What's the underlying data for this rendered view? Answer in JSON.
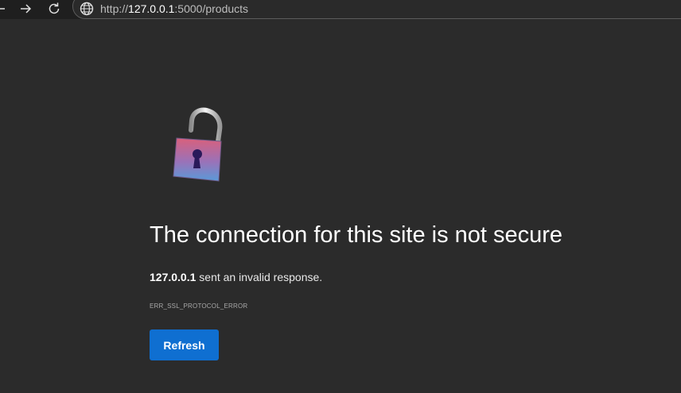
{
  "browser": {
    "url_scheme": "http://",
    "url_host": "127.0.0.1",
    "url_rest": ":5000/products",
    "icons": [
      "back-arrow-icon",
      "forward-arrow-icon",
      "reload-icon",
      "globe-icon"
    ]
  },
  "error_page": {
    "title": "The connection for this site is not secure",
    "host": "127.0.0.1",
    "message_suffix": " sent an invalid response.",
    "error_code": "ERR_SSL_PROTOCOL_ERROR",
    "refresh_label": "Refresh",
    "illustration": "open-padlock-icon"
  },
  "colors": {
    "background": "#2b2b2b",
    "button": "#0f6fd1"
  }
}
